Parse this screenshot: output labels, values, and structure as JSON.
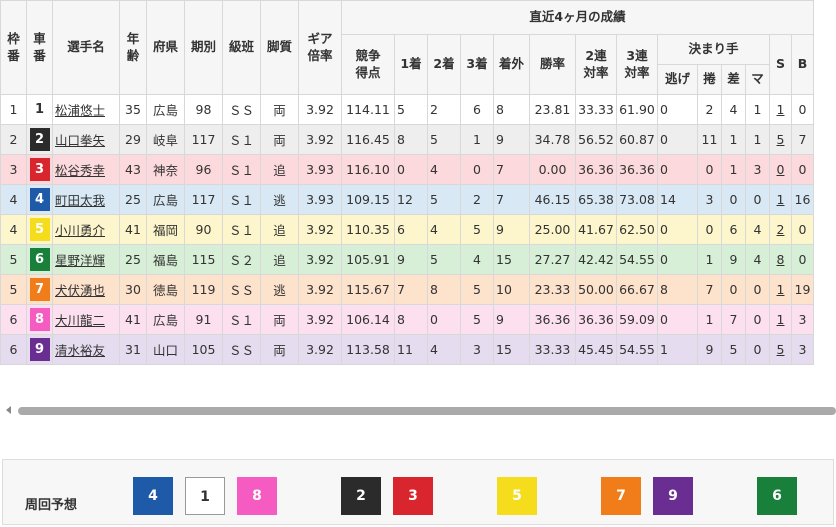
{
  "headers": {
    "waku": "枠\n番",
    "shaban": "車\n番",
    "name": "選手名",
    "age": "年\n齢",
    "pref": "府県",
    "ki": "期別",
    "kyuhan": "級班",
    "kyakushitsu": "脚質",
    "gear": "ギア\n倍率",
    "recent": "直近4ヶ月の成績",
    "score": "競争\n得点",
    "first": "1着",
    "second": "2着",
    "third": "3着",
    "outside": "着外",
    "win_rate": "勝率",
    "rate2": "2連\n対率",
    "rate3": "3連\n対率",
    "kimarite": "決まり手",
    "nige": "逃げ",
    "makuri": "捲",
    "sashi": "差",
    "mark": "マ",
    "s": "S",
    "b": "B"
  },
  "rows": [
    {
      "waku": "1",
      "shaban": "1",
      "name": "松浦悠士",
      "age": "35",
      "pref": "広島",
      "ki": "98",
      "kyuhan": "ＳＳ",
      "kyaku": "両",
      "gear": "3.92",
      "score": "114.11",
      "f1": "5",
      "f2": "2",
      "f3": "6",
      "out": "8",
      "win": "23.81",
      "r2": "33.33",
      "r3": "61.90",
      "nige": "0",
      "makuri": "2",
      "sashi": "4",
      "mark": "1",
      "s": "1",
      "b": "0",
      "bg": "#ffffff",
      "fg": "#333333",
      "border": "#333333"
    },
    {
      "waku": "2",
      "shaban": "2",
      "name": "山口拳矢",
      "age": "29",
      "pref": "岐阜",
      "ki": "117",
      "kyuhan": "Ｓ１",
      "kyaku": "両",
      "gear": "3.92",
      "score": "116.45",
      "f1": "8",
      "f2": "5",
      "f3": "1",
      "out": "9",
      "win": "34.78",
      "r2": "56.52",
      "r3": "60.87",
      "nige": "0",
      "makuri": "11",
      "sashi": "1",
      "mark": "1",
      "s": "5",
      "b": "7",
      "bg": "#2b2b2b",
      "fg": "#ffffff",
      "border": "#2b2b2b"
    },
    {
      "waku": "3",
      "shaban": "3",
      "name": "松谷秀幸",
      "age": "43",
      "pref": "神奈",
      "ki": "96",
      "kyuhan": "Ｓ１",
      "kyaku": "追",
      "gear": "3.93",
      "score": "116.10",
      "f1": "0",
      "f2": "4",
      "f3": "0",
      "out": "7",
      "win": "0.00",
      "r2": "36.36",
      "r3": "36.36",
      "nige": "0",
      "makuri": "0",
      "sashi": "1",
      "mark": "3",
      "s": "0",
      "b": "0",
      "bg": "#d9262e",
      "fg": "#ffffff",
      "border": "#d9262e"
    },
    {
      "waku": "4",
      "shaban": "4",
      "name": "町田太我",
      "age": "25",
      "pref": "広島",
      "ki": "117",
      "kyuhan": "Ｓ１",
      "kyaku": "逃",
      "gear": "3.93",
      "score": "109.15",
      "f1": "12",
      "f2": "5",
      "f3": "2",
      "out": "7",
      "win": "46.15",
      "r2": "65.38",
      "r3": "73.08",
      "nige": "14",
      "makuri": "3",
      "sashi": "0",
      "mark": "0",
      "s": "1",
      "b": "16",
      "bg": "#1f5aa8",
      "fg": "#ffffff",
      "border": "#1f5aa8"
    },
    {
      "waku": "4",
      "shaban": "5",
      "name": "小川勇介",
      "age": "41",
      "pref": "福岡",
      "ki": "90",
      "kyuhan": "Ｓ１",
      "kyaku": "追",
      "gear": "3.92",
      "score": "110.35",
      "f1": "6",
      "f2": "4",
      "f3": "5",
      "out": "9",
      "win": "25.00",
      "r2": "41.67",
      "r3": "62.50",
      "nige": "0",
      "makuri": "0",
      "sashi": "6",
      "mark": "4",
      "s": "2",
      "b": "0",
      "bg": "#f5dc1c",
      "fg": "#ffffff",
      "border": "#f5dc1c"
    },
    {
      "waku": "5",
      "shaban": "6",
      "name": "星野洋輝",
      "age": "25",
      "pref": "福島",
      "ki": "115",
      "kyuhan": "Ｓ２",
      "kyaku": "追",
      "gear": "3.92",
      "score": "105.91",
      "f1": "9",
      "f2": "5",
      "f3": "4",
      "out": "15",
      "win": "27.27",
      "r2": "42.42",
      "r3": "54.55",
      "nige": "0",
      "makuri": "1",
      "sashi": "9",
      "mark": "4",
      "s": "8",
      "b": "0",
      "bg": "#18803a",
      "fg": "#ffffff",
      "border": "#18803a"
    },
    {
      "waku": "5",
      "shaban": "7",
      "name": "犬伏湧也",
      "age": "30",
      "pref": "徳島",
      "ki": "119",
      "kyuhan": "ＳＳ",
      "kyaku": "逃",
      "gear": "3.92",
      "score": "115.67",
      "f1": "7",
      "f2": "8",
      "f3": "5",
      "out": "10",
      "win": "23.33",
      "r2": "50.00",
      "r3": "66.67",
      "nige": "8",
      "makuri": "7",
      "sashi": "0",
      "mark": "0",
      "s": "1",
      "b": "19",
      "bg": "#f07d1a",
      "fg": "#ffffff",
      "border": "#f07d1a"
    },
    {
      "waku": "6",
      "shaban": "8",
      "name": "大川龍二",
      "age": "41",
      "pref": "広島",
      "ki": "91",
      "kyuhan": "Ｓ１",
      "kyaku": "両",
      "gear": "3.92",
      "score": "106.14",
      "f1": "8",
      "f2": "0",
      "f3": "5",
      "out": "9",
      "win": "36.36",
      "r2": "36.36",
      "r3": "59.09",
      "nige": "0",
      "makuri": "1",
      "sashi": "7",
      "mark": "0",
      "s": "1",
      "b": "3",
      "bg": "#f55bc0",
      "fg": "#ffffff",
      "border": "#f55bc0"
    },
    {
      "waku": "6",
      "shaban": "9",
      "name": "清水裕友",
      "age": "31",
      "pref": "山口",
      "ki": "105",
      "kyuhan": "ＳＳ",
      "kyaku": "両",
      "gear": "3.92",
      "score": "113.58",
      "f1": "11",
      "f2": "4",
      "f3": "3",
      "out": "15",
      "win": "33.33",
      "r2": "45.45",
      "r3": "54.55",
      "nige": "1",
      "makuri": "9",
      "sashi": "5",
      "mark": "0",
      "s": "5",
      "b": "3",
      "bg": "#6a2e92",
      "fg": "#ffffff",
      "border": "#6a2e92"
    }
  ],
  "yoso": {
    "label": "周回予想",
    "chips": [
      {
        "num": "4",
        "bg": "#1f5aa8",
        "fg": "#ffffff"
      },
      {
        "num": "1",
        "bg": "#ffffff",
        "fg": "#333333"
      },
      {
        "num": "8",
        "bg": "#f55bc0",
        "fg": "#ffffff"
      },
      {
        "num": "2",
        "bg": "#2b2b2b",
        "fg": "#ffffff"
      },
      {
        "num": "3",
        "bg": "#d9262e",
        "fg": "#ffffff"
      },
      {
        "num": "5",
        "bg": "#f5dc1c",
        "fg": "#ffffff"
      },
      {
        "num": "7",
        "bg": "#f07d1a",
        "fg": "#ffffff"
      },
      {
        "num": "9",
        "bg": "#6a2e92",
        "fg": "#ffffff"
      },
      {
        "num": "6",
        "bg": "#18803a",
        "fg": "#ffffff"
      }
    ]
  }
}
